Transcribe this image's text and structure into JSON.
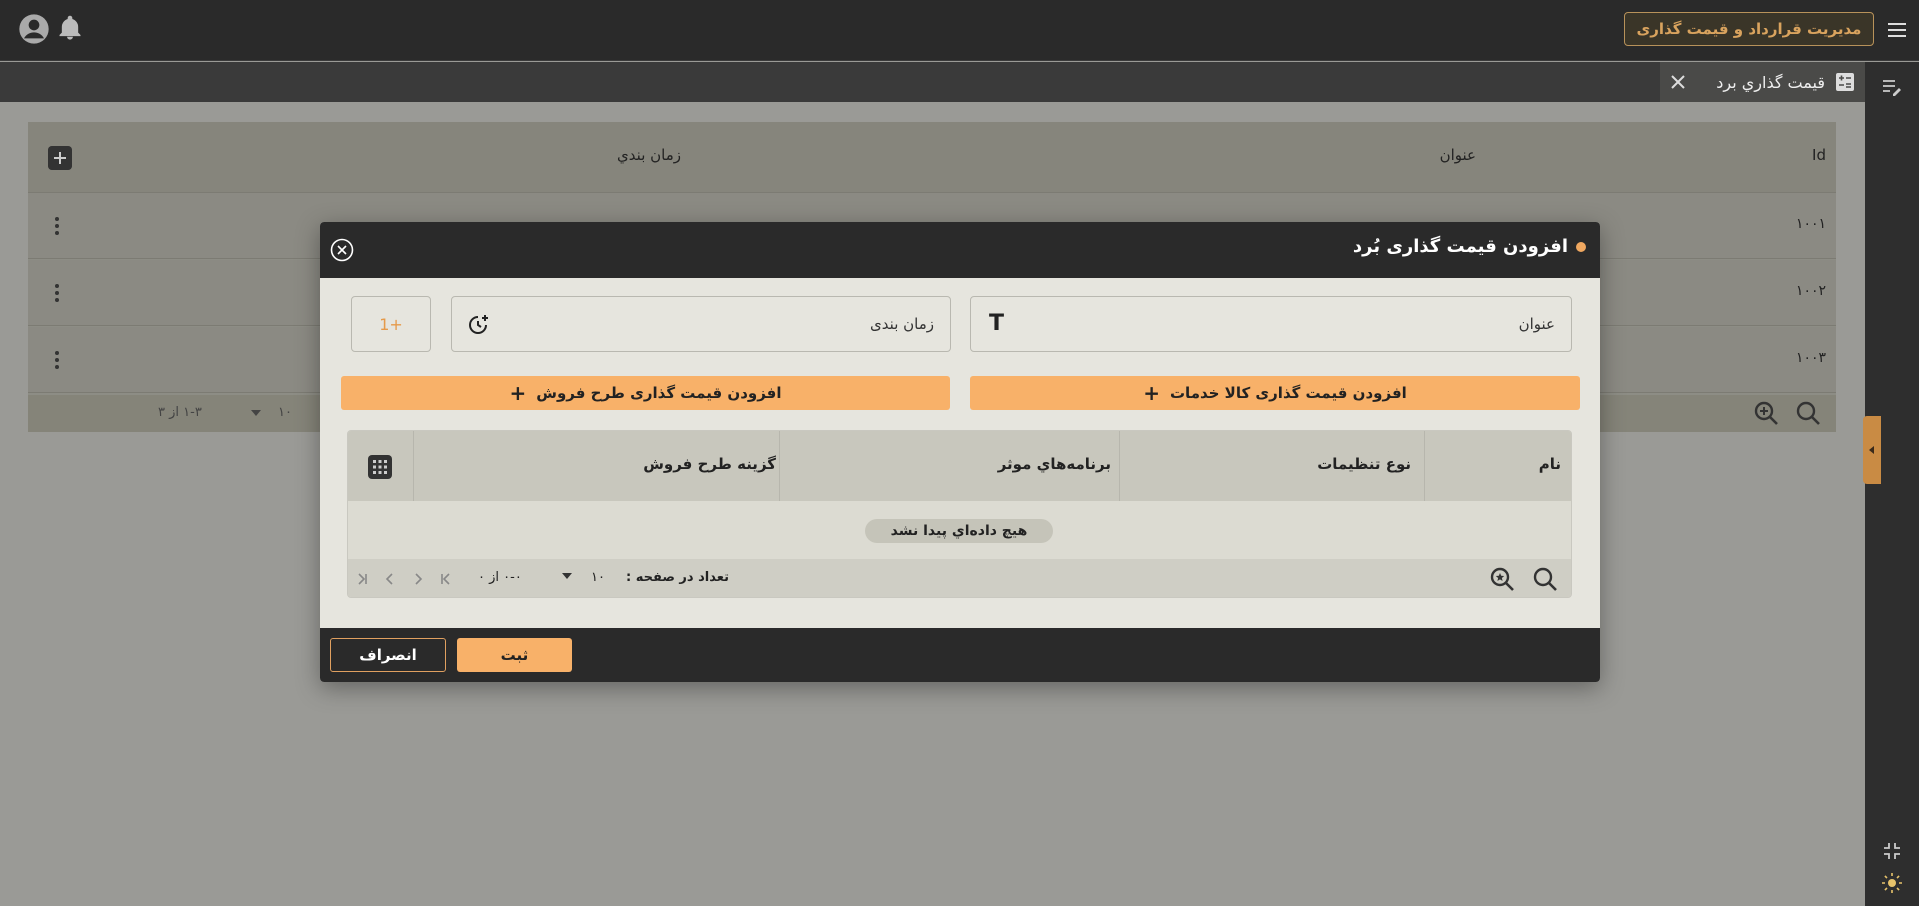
{
  "topbar": {
    "app_title": "مدیریت قرارداد و قیمت گذاری"
  },
  "tab": {
    "label": "قيمت گذاري برد"
  },
  "background_table": {
    "columns": {
      "id": "Id",
      "title": "عنوان",
      "schedule": "زمان بندي"
    },
    "rows": [
      {
        "id": "۱۰۰۱"
      },
      {
        "id": "۱۰۰۲"
      },
      {
        "id": "۱۰۰۳"
      }
    ],
    "page_size": "۱۰",
    "range": "۱-۳ از ۳"
  },
  "modal": {
    "title": "افزودن قیمت گذاری بُرد",
    "title_field_label": "عنوان",
    "schedule_field_label": "زمان بندی",
    "plus_one_label": "+1",
    "add_services_label": "افزودن قیمت گذاری کالا خدمات",
    "add_sales_plan_label": "افزودن قیمت گذاری طرح فروش",
    "inner_table": {
      "columns": {
        "name": "نام",
        "settings_type": "نوع تنظیمات",
        "effective_programs": "برنامه‌هاي موثر",
        "sales_plan_option": "گزینه طرح فروش"
      },
      "empty_message": "هیچ داده‌اي پيدا نشد",
      "page_size_label": "تعداد در صفحه :",
      "page_size": "۱۰",
      "range": "۰-۰ از ۰"
    },
    "submit_label": "ثبت",
    "cancel_label": "انصراف"
  }
}
